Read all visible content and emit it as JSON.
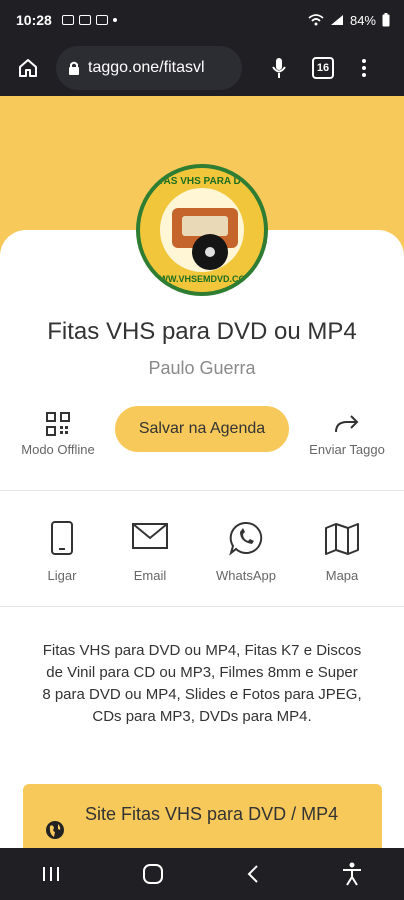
{
  "status_bar": {
    "time": "10:28",
    "battery": "84%"
  },
  "browser": {
    "url": "taggo.one/fitasvl",
    "tab_count": "16"
  },
  "profile": {
    "logo_text_top": "FITAS VHS PARA DVD",
    "logo_text_bottom": "WWW.VHSEMDVD.COM",
    "title": "Fitas VHS para DVD ou MP4",
    "owner": "Paulo Guerra"
  },
  "actions": {
    "offline_label": "Modo Offline",
    "save_label": "Salvar na Agenda",
    "share_label": "Enviar Taggo"
  },
  "contacts": [
    {
      "label": "Ligar",
      "icon": "phone-icon"
    },
    {
      "label": "Email",
      "icon": "email-icon"
    },
    {
      "label": "WhatsApp",
      "icon": "whatsapp-icon"
    },
    {
      "label": "Mapa",
      "icon": "map-icon"
    }
  ],
  "description": "Fitas VHS para DVD ou MP4, Fitas K7 e Discos de Vinil para CD ou MP3, Filmes 8mm e Super 8 para DVD ou MP4, Slides e Fotos para JPEG, CDs para MP3, DVDs para MP4.",
  "link": {
    "label": "Site Fitas VHS para DVD / MP4",
    "icon": "globe-icon"
  },
  "colors": {
    "accent": "#f7c95a",
    "dark": "#1f1f24"
  }
}
